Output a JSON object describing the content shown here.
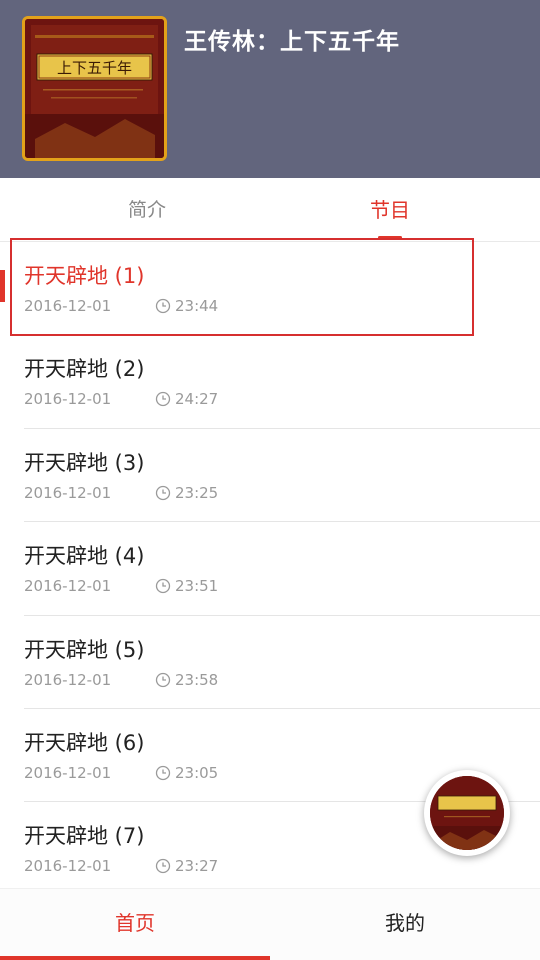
{
  "header": {
    "album_title": "王传林：上下五千年",
    "cover": {
      "banner_text": "上下五千年",
      "accent_color": "#e3a21a",
      "background_color": "#6d1410"
    },
    "background_color": "#62657d"
  },
  "tabs": [
    {
      "label": "简介",
      "active": false
    },
    {
      "label": "节目",
      "active": true
    }
  ],
  "episodes": [
    {
      "title": "开天辟地 (1)",
      "date": "2016-12-01",
      "duration": "23:44",
      "active": true
    },
    {
      "title": "开天辟地 (2)",
      "date": "2016-12-01",
      "duration": "24:27",
      "active": false
    },
    {
      "title": "开天辟地 (3)",
      "date": "2016-12-01",
      "duration": "23:25",
      "active": false
    },
    {
      "title": "开天辟地 (4)",
      "date": "2016-12-01",
      "duration": "23:51",
      "active": false
    },
    {
      "title": "开天辟地 (5)",
      "date": "2016-12-01",
      "duration": "23:58",
      "active": false
    },
    {
      "title": "开天辟地 (6)",
      "date": "2016-12-01",
      "duration": "23:05",
      "active": false
    },
    {
      "title": "开天辟地 (7)",
      "date": "2016-12-01",
      "duration": "23:27",
      "active": false
    }
  ],
  "bottom_nav": [
    {
      "label": "首页",
      "active": true
    },
    {
      "label": "我的",
      "active": false
    }
  ],
  "colors": {
    "accent": "#e0352b",
    "secondary_text": "#9a9a9a"
  },
  "icons": {
    "duration": "clock-icon",
    "player": "album-cover-player-icon"
  }
}
